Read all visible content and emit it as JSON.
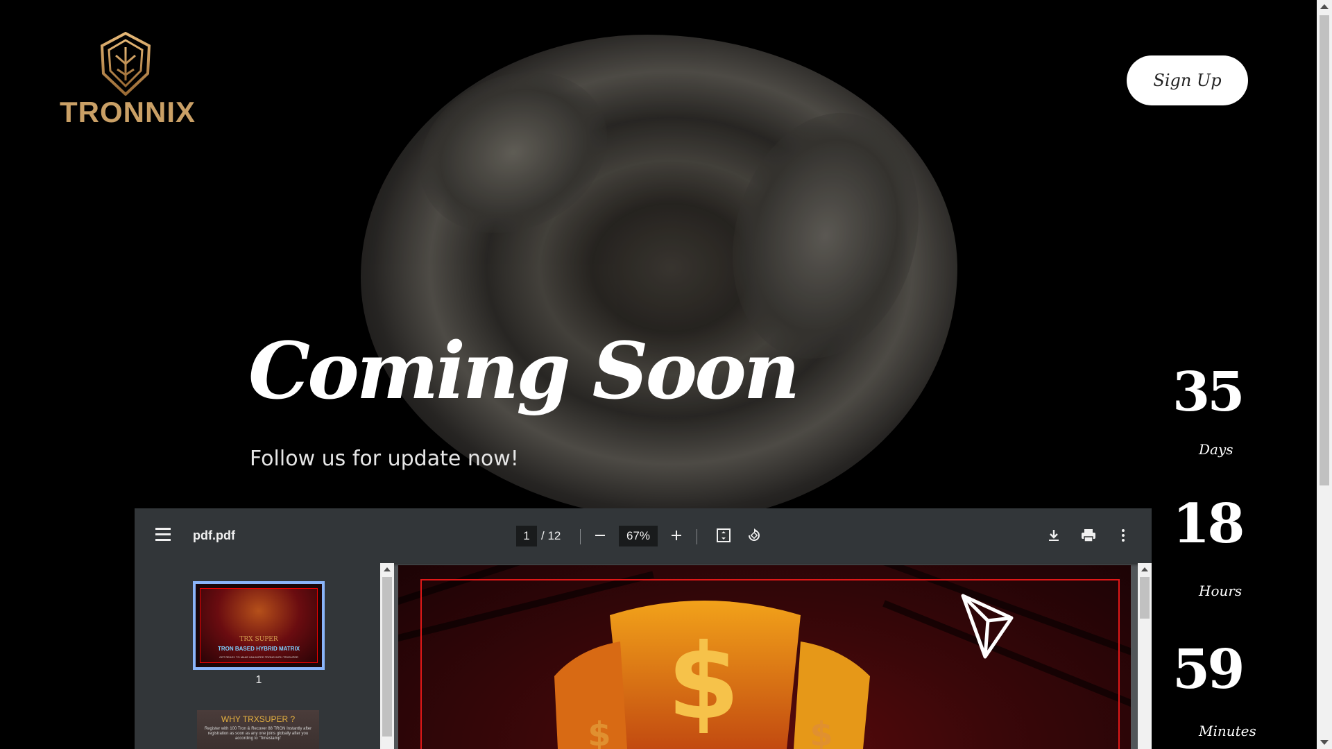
{
  "brand": {
    "name": "TRONNIX",
    "logo_color": "#caa066"
  },
  "header": {
    "signup_label": "Sign Up"
  },
  "hero": {
    "headline": "Coming Soon",
    "subtitle": "Follow us for update now!"
  },
  "countdown": [
    {
      "value": "35",
      "label": "Days"
    },
    {
      "value": "18",
      "label": "Hours"
    },
    {
      "value": "59",
      "label": "Minutes"
    }
  ],
  "pdf_viewer": {
    "file_name": "pdf.pdf",
    "current_page": "1",
    "total_pages": "/ 12",
    "zoom": "67%",
    "icons": [
      "menu-icon",
      "zoom-out-icon",
      "zoom-in-icon",
      "fit-page-icon",
      "rotate-icon",
      "download-icon",
      "print-icon",
      "more-icon"
    ],
    "thumbnails": [
      {
        "page": "1",
        "title": "TRX SUPER",
        "subtitle": "TRON BASED HYBRID MATRIX",
        "tagline": "GET READY TO MAKE UNLIMITED TRONS WITH TRXSUPER"
      },
      {
        "title": "WHY TRXSUPER ?",
        "body": "Register with 100 Tron & Recover 88 TRON  Instantly after registration as soon as any one  joins globally after you according to 'Timestamp'"
      }
    ],
    "accent_color": "#8ab4f8"
  }
}
